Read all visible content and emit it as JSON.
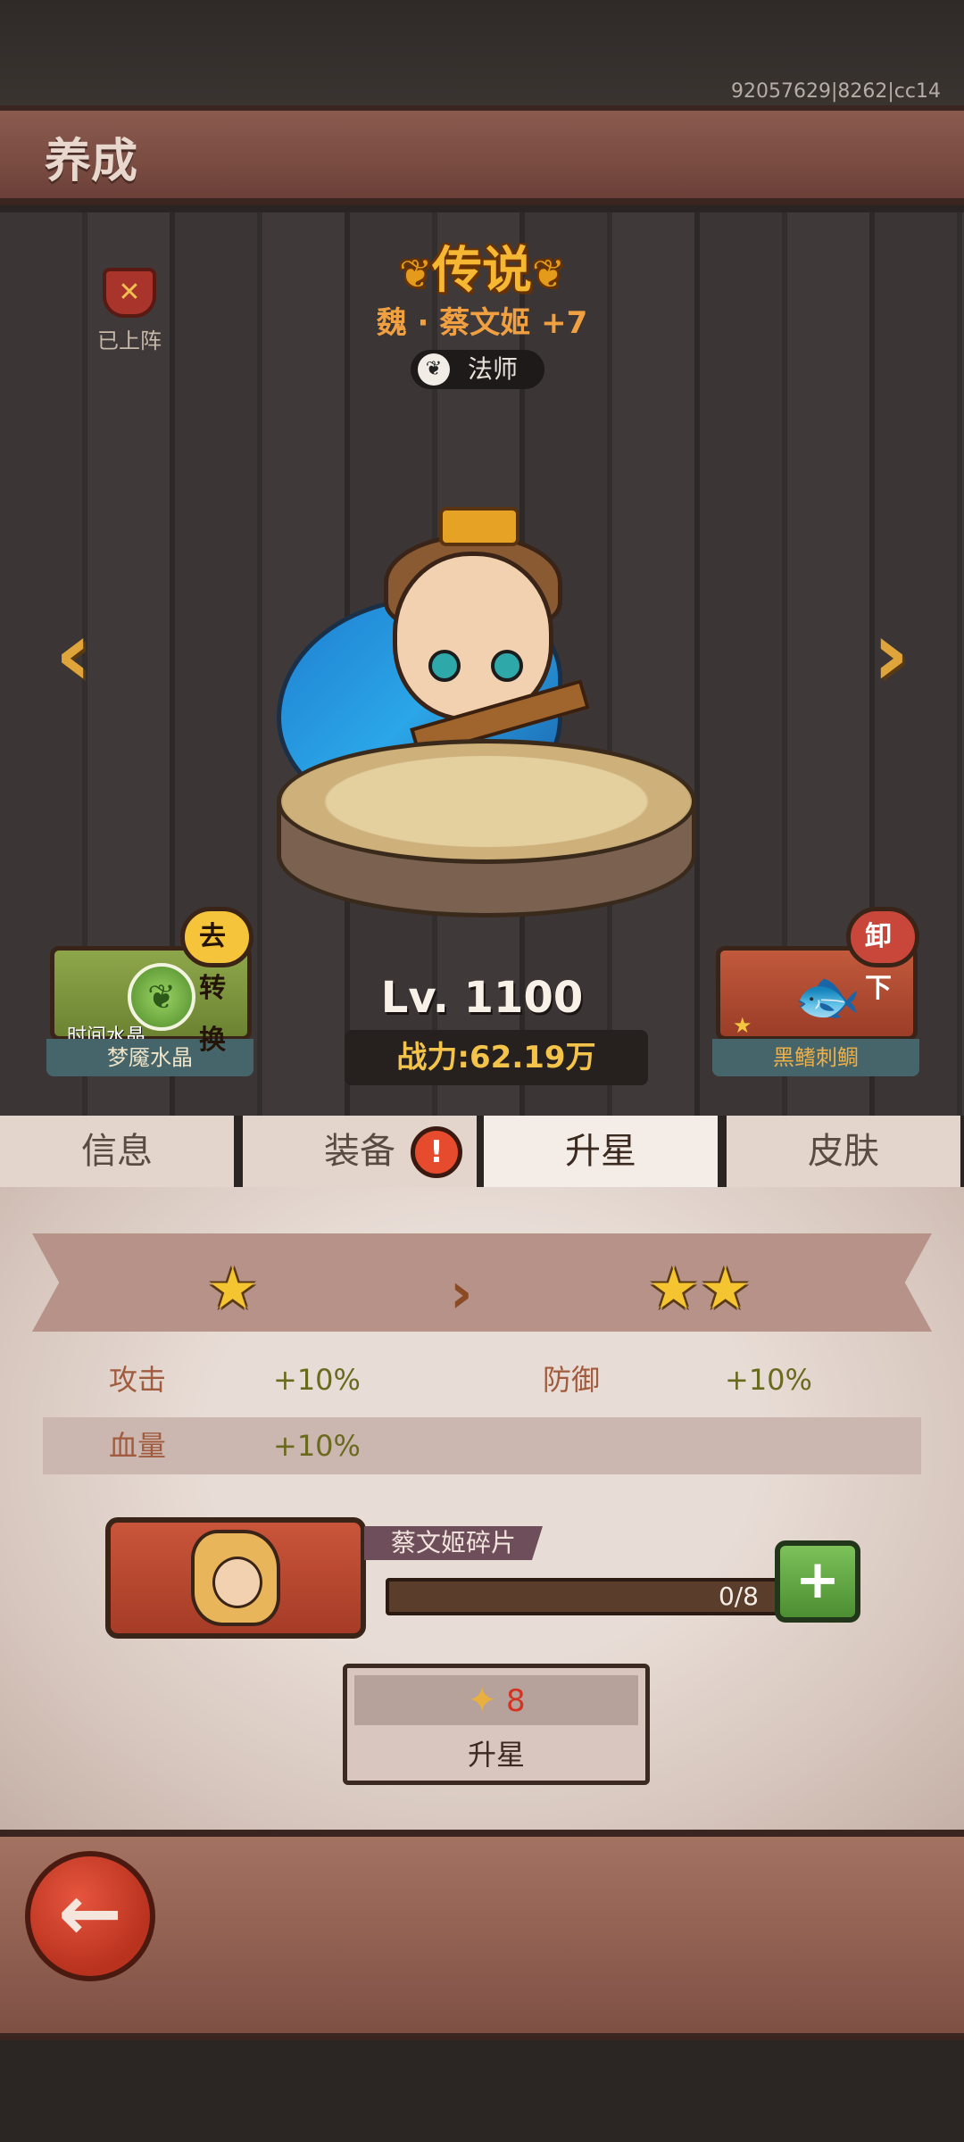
{
  "meta": {
    "build_id": "92057629|8262|cc14"
  },
  "header": {
    "title": "养成"
  },
  "hero": {
    "rarity": "传说",
    "name": "魏 · 蔡文姬 +7",
    "class": "法师",
    "deployed_label": "已上阵",
    "level": "Lv. 1100",
    "power": "战力:62.19万"
  },
  "left_slot": {
    "bubble": "去转换",
    "sub_label": "时间水晶",
    "caption": "梦魇水晶",
    "icon": "leaf-crystal-icon"
  },
  "right_slot": {
    "bubble": "卸下",
    "caption": "黑鳍刺鲷",
    "icon": "fish-icon"
  },
  "tabs": [
    {
      "label": "信息"
    },
    {
      "label": "装备",
      "alert": "!"
    },
    {
      "label": "升星",
      "active": true
    },
    {
      "label": "皮肤"
    }
  ],
  "star_up": {
    "current_stars": 1,
    "next_stars": 2,
    "stats": [
      {
        "label": "攻击",
        "value": "+10%"
      },
      {
        "label": "防御",
        "value": "+10%"
      },
      {
        "label": "血量",
        "value": "+10%"
      }
    ],
    "shard_name": "蔡文姬碎片",
    "progress_text": "0/8",
    "progress": 0,
    "cost": "8",
    "button_label": "升星"
  },
  "colors": {
    "accent_gold": "#f5c531",
    "power_gold": "#f3c34a",
    "plus_green": "#7cc15a",
    "back_red": "#b8321e"
  }
}
